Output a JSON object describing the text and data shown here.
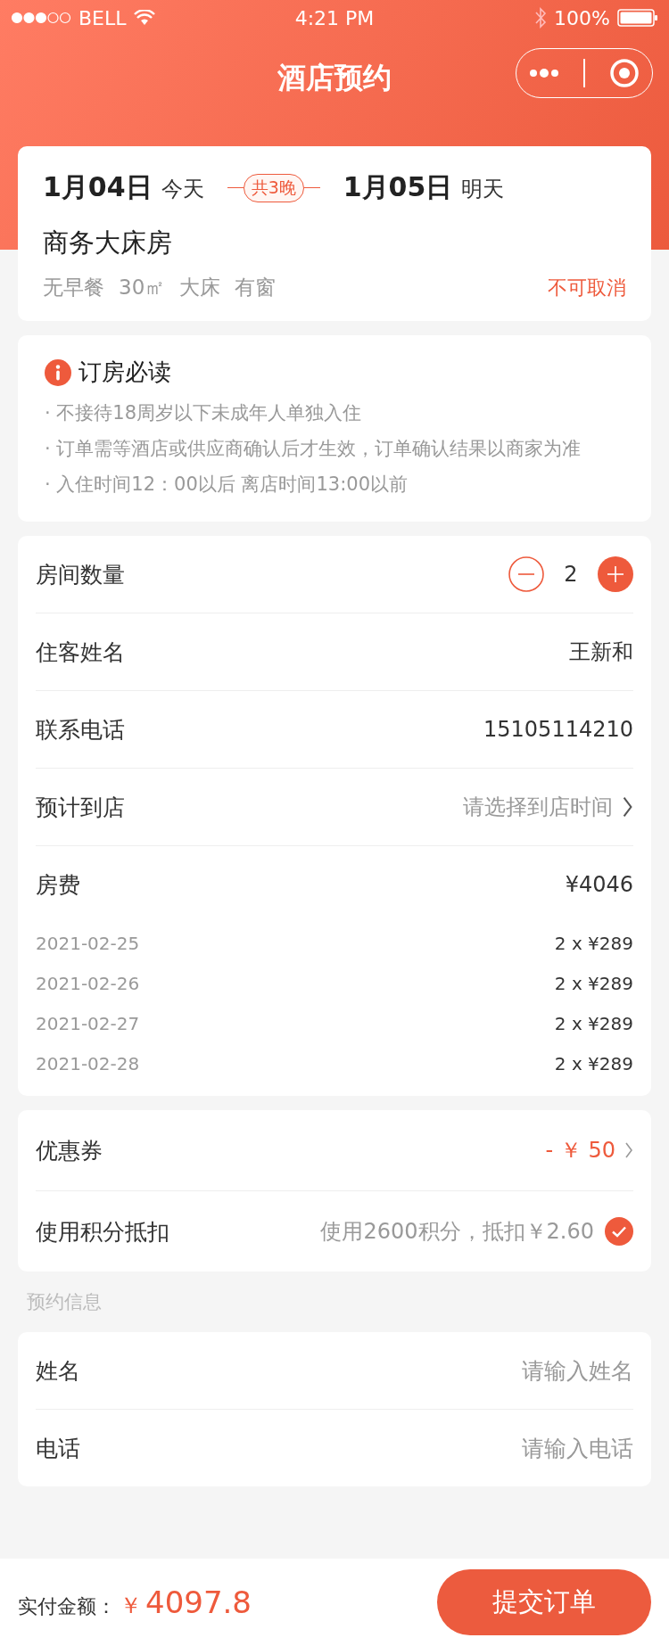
{
  "status_bar": {
    "carrier": "BELL",
    "time": "4:21 PM",
    "battery": "100%"
  },
  "nav": {
    "title": "酒店预约"
  },
  "stay": {
    "checkin": {
      "date": "1月04日",
      "day": "今天"
    },
    "nights": "共3晚",
    "checkout": {
      "date": "1月05日",
      "day": "明天"
    },
    "room_name": "商务大床房",
    "features": [
      "无早餐",
      "30㎡",
      "大床",
      "有窗"
    ],
    "policy": "不可取消"
  },
  "notice": {
    "title": "订房必读",
    "items": [
      "· 不接待18周岁以下未成年人单独入住",
      "· 订单需等酒店或供应商确认后才生效，订单确认结果以商家为准",
      "· 入住时间12：00以后 离店时间13:00以前"
    ]
  },
  "order": {
    "room_count": {
      "label": "房间数量",
      "value": "2"
    },
    "rows": [
      {
        "kind": "value",
        "label": "住客姓名",
        "value": "王新和"
      },
      {
        "kind": "value",
        "label": "联系电话",
        "value": "15105114210"
      },
      {
        "kind": "picker",
        "label": "预计到店",
        "placeholder": "请选择到店时间"
      }
    ],
    "fee": {
      "label": "房费",
      "total": "¥4046",
      "nights": [
        {
          "date": "2021-02-25",
          "price": "2 x ¥289"
        },
        {
          "date": "2021-02-26",
          "price": "2 x ¥289"
        },
        {
          "date": "2021-02-27",
          "price": "2 x ¥289"
        },
        {
          "date": "2021-02-28",
          "price": "2 x ¥289"
        }
      ]
    }
  },
  "discounts": {
    "coupon": {
      "label": "优惠券",
      "value": "- ￥ 50"
    },
    "points": {
      "label": "使用积分抵扣",
      "value": "使用2600积分，抵扣￥2.60",
      "checked": true
    }
  },
  "section_label": "预约信息",
  "contact_fields": [
    {
      "label": "姓名",
      "placeholder": "请输入姓名"
    },
    {
      "label": "电话",
      "placeholder": "请输入电话"
    }
  ],
  "footer": {
    "total_label": "实付金额：",
    "currency": "￥",
    "amount": "4097.8",
    "submit": "提交订单"
  }
}
